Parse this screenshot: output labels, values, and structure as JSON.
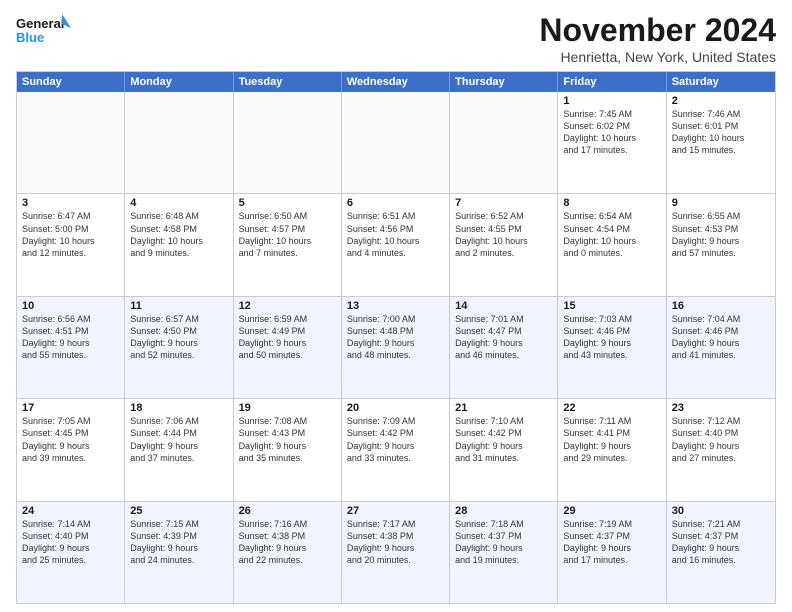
{
  "logo": {
    "line1": "General",
    "line2": "Blue"
  },
  "title": "November 2024",
  "subtitle": "Henrietta, New York, United States",
  "header_days": [
    "Sunday",
    "Monday",
    "Tuesday",
    "Wednesday",
    "Thursday",
    "Friday",
    "Saturday"
  ],
  "rows": [
    [
      {
        "day": "",
        "content": ""
      },
      {
        "day": "",
        "content": ""
      },
      {
        "day": "",
        "content": ""
      },
      {
        "day": "",
        "content": ""
      },
      {
        "day": "",
        "content": ""
      },
      {
        "day": "1",
        "content": "Sunrise: 7:45 AM\nSunset: 6:02 PM\nDaylight: 10 hours\nand 17 minutes."
      },
      {
        "day": "2",
        "content": "Sunrise: 7:46 AM\nSunset: 6:01 PM\nDaylight: 10 hours\nand 15 minutes."
      }
    ],
    [
      {
        "day": "3",
        "content": "Sunrise: 6:47 AM\nSunset: 5:00 PM\nDaylight: 10 hours\nand 12 minutes."
      },
      {
        "day": "4",
        "content": "Sunrise: 6:48 AM\nSunset: 4:58 PM\nDaylight: 10 hours\nand 9 minutes."
      },
      {
        "day": "5",
        "content": "Sunrise: 6:50 AM\nSunset: 4:57 PM\nDaylight: 10 hours\nand 7 minutes."
      },
      {
        "day": "6",
        "content": "Sunrise: 6:51 AM\nSunset: 4:56 PM\nDaylight: 10 hours\nand 4 minutes."
      },
      {
        "day": "7",
        "content": "Sunrise: 6:52 AM\nSunset: 4:55 PM\nDaylight: 10 hours\nand 2 minutes."
      },
      {
        "day": "8",
        "content": "Sunrise: 6:54 AM\nSunset: 4:54 PM\nDaylight: 10 hours\nand 0 minutes."
      },
      {
        "day": "9",
        "content": "Sunrise: 6:55 AM\nSunset: 4:53 PM\nDaylight: 9 hours\nand 57 minutes."
      }
    ],
    [
      {
        "day": "10",
        "content": "Sunrise: 6:56 AM\nSunset: 4:51 PM\nDaylight: 9 hours\nand 55 minutes."
      },
      {
        "day": "11",
        "content": "Sunrise: 6:57 AM\nSunset: 4:50 PM\nDaylight: 9 hours\nand 52 minutes."
      },
      {
        "day": "12",
        "content": "Sunrise: 6:59 AM\nSunset: 4:49 PM\nDaylight: 9 hours\nand 50 minutes."
      },
      {
        "day": "13",
        "content": "Sunrise: 7:00 AM\nSunset: 4:48 PM\nDaylight: 9 hours\nand 48 minutes."
      },
      {
        "day": "14",
        "content": "Sunrise: 7:01 AM\nSunset: 4:47 PM\nDaylight: 9 hours\nand 46 minutes."
      },
      {
        "day": "15",
        "content": "Sunrise: 7:03 AM\nSunset: 4:46 PM\nDaylight: 9 hours\nand 43 minutes."
      },
      {
        "day": "16",
        "content": "Sunrise: 7:04 AM\nSunset: 4:46 PM\nDaylight: 9 hours\nand 41 minutes."
      }
    ],
    [
      {
        "day": "17",
        "content": "Sunrise: 7:05 AM\nSunset: 4:45 PM\nDaylight: 9 hours\nand 39 minutes."
      },
      {
        "day": "18",
        "content": "Sunrise: 7:06 AM\nSunset: 4:44 PM\nDaylight: 9 hours\nand 37 minutes."
      },
      {
        "day": "19",
        "content": "Sunrise: 7:08 AM\nSunset: 4:43 PM\nDaylight: 9 hours\nand 35 minutes."
      },
      {
        "day": "20",
        "content": "Sunrise: 7:09 AM\nSunset: 4:42 PM\nDaylight: 9 hours\nand 33 minutes."
      },
      {
        "day": "21",
        "content": "Sunrise: 7:10 AM\nSunset: 4:42 PM\nDaylight: 9 hours\nand 31 minutes."
      },
      {
        "day": "22",
        "content": "Sunrise: 7:11 AM\nSunset: 4:41 PM\nDaylight: 9 hours\nand 29 minutes."
      },
      {
        "day": "23",
        "content": "Sunrise: 7:12 AM\nSunset: 4:40 PM\nDaylight: 9 hours\nand 27 minutes."
      }
    ],
    [
      {
        "day": "24",
        "content": "Sunrise: 7:14 AM\nSunset: 4:40 PM\nDaylight: 9 hours\nand 25 minutes."
      },
      {
        "day": "25",
        "content": "Sunrise: 7:15 AM\nSunset: 4:39 PM\nDaylight: 9 hours\nand 24 minutes."
      },
      {
        "day": "26",
        "content": "Sunrise: 7:16 AM\nSunset: 4:38 PM\nDaylight: 9 hours\nand 22 minutes."
      },
      {
        "day": "27",
        "content": "Sunrise: 7:17 AM\nSunset: 4:38 PM\nDaylight: 9 hours\nand 20 minutes."
      },
      {
        "day": "28",
        "content": "Sunrise: 7:18 AM\nSunset: 4:37 PM\nDaylight: 9 hours\nand 19 minutes."
      },
      {
        "day": "29",
        "content": "Sunrise: 7:19 AM\nSunset: 4:37 PM\nDaylight: 9 hours\nand 17 minutes."
      },
      {
        "day": "30",
        "content": "Sunrise: 7:21 AM\nSunset: 4:37 PM\nDaylight: 9 hours\nand 16 minutes."
      }
    ]
  ]
}
